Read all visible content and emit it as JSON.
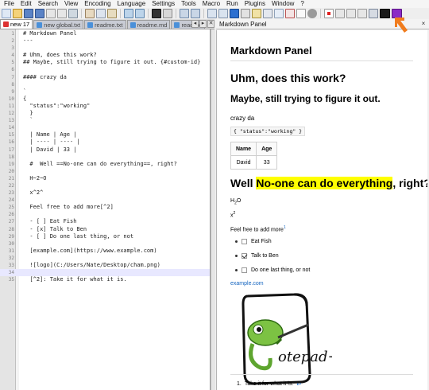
{
  "menu": [
    "File",
    "Edit",
    "Search",
    "View",
    "Encoding",
    "Language",
    "Settings",
    "Tools",
    "Macro",
    "Run",
    "Plugins",
    "Window",
    "?"
  ],
  "tabs": [
    {
      "label": "new 17",
      "active": true
    },
    {
      "label": "new global.txt",
      "active": false
    },
    {
      "label": "readme.txt",
      "active": false
    },
    {
      "label": "readme.md",
      "active": false
    },
    {
      "label": "readme",
      "active": false
    }
  ],
  "editor": {
    "lines": [
      {
        "n": "1",
        "text": "# Markdown Panel"
      },
      {
        "n": "2",
        "text": "---"
      },
      {
        "n": "3",
        "text": ""
      },
      {
        "n": "4",
        "text": "# Uhm, does this work?"
      },
      {
        "n": "5",
        "text": "## Maybe, still trying to figure it out. {#custom-id}"
      },
      {
        "n": "6",
        "text": ""
      },
      {
        "n": "7",
        "text": "#### crazy da"
      },
      {
        "n": "8",
        "text": ""
      },
      {
        "n": "9",
        "text": "`"
      },
      {
        "n": "10",
        "text": "{"
      },
      {
        "n": "11",
        "text": "  \"status\":\"working\""
      },
      {
        "n": "12",
        "text": "  }"
      },
      {
        "n": "13",
        "text": "  `"
      },
      {
        "n": "14",
        "text": ""
      },
      {
        "n": "15",
        "text": "  | Name | Age |"
      },
      {
        "n": "16",
        "text": "  | ---- | ---- |"
      },
      {
        "n": "17",
        "text": "  | David | 33 |"
      },
      {
        "n": "18",
        "text": ""
      },
      {
        "n": "19",
        "text": "  #  Well ==No-one can do everything==, right?"
      },
      {
        "n": "20",
        "text": ""
      },
      {
        "n": "21",
        "text": "  H~2~O"
      },
      {
        "n": "22",
        "text": ""
      },
      {
        "n": "23",
        "text": "  x^2^"
      },
      {
        "n": "24",
        "text": ""
      },
      {
        "n": "25",
        "text": "  Feel free to add more[^2]"
      },
      {
        "n": "26",
        "text": ""
      },
      {
        "n": "27",
        "text": "  - [ ] Eat Fish"
      },
      {
        "n": "28",
        "text": "  - [x] Talk to Ben"
      },
      {
        "n": "29",
        "text": "  - [ ] Do one last thing, or not"
      },
      {
        "n": "30",
        "text": ""
      },
      {
        "n": "31",
        "text": "  [example.com](https://www.example.com)"
      },
      {
        "n": "32",
        "text": ""
      },
      {
        "n": "33",
        "text": "  ![logo](C:/Users/Nate/Desktop/cham.png)"
      },
      {
        "n": "34",
        "text": ""
      },
      {
        "n": "35",
        "text": "  [^2]: Take it for what it is."
      }
    ]
  },
  "panel": {
    "title": "Markdown Panel",
    "close": "×"
  },
  "preview": {
    "h1": "Markdown Panel",
    "h2a": "Uhm, does this work?",
    "h3": "Maybe, still trying to figure it out.",
    "crazy": "crazy da",
    "code": "{ \"status\":\"working\" }",
    "table": {
      "headers": [
        "Name",
        "Age"
      ],
      "row": [
        "David",
        "33"
      ]
    },
    "h2b_prefix": "Well ",
    "h2b_highlight": "No-one can do everything",
    "h2b_suffix": ", right?",
    "h2o_h": "H",
    "h2o_sub": "2",
    "h2o_o": "O",
    "x": "x",
    "x_sup": "2",
    "more": "Feel free to add more",
    "more_sup": "1",
    "tasks": [
      {
        "label": "Eat Fish",
        "checked": false
      },
      {
        "label": "Talk to Ben",
        "checked": true
      },
      {
        "label": "Do one last thing, or not",
        "checked": false
      }
    ],
    "link": "example.com",
    "logo_text": "otepad++",
    "footnote_num": "1.",
    "footnote": "Take it for what it is.",
    "footnote_back": "↩"
  },
  "colors": {
    "highlight": "#ffff00",
    "link": "#1565c0",
    "arrow": "#f07c1e",
    "chameleon": "#7cc243"
  }
}
